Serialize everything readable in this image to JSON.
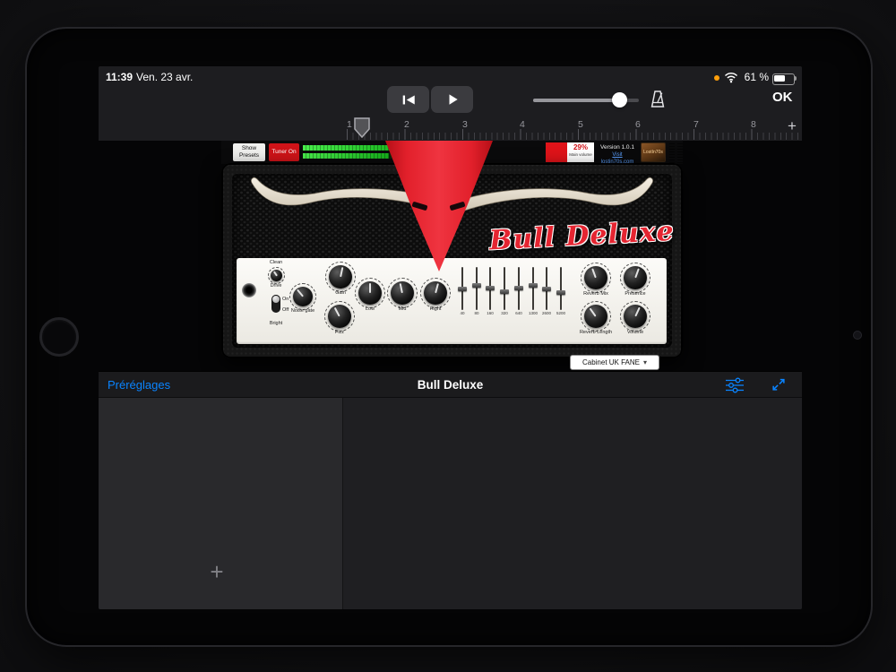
{
  "status": {
    "time": "11:39",
    "date": "Ven. 23 avr.",
    "battery": "61 %"
  },
  "toolbar": {
    "ok": "OK"
  },
  "ruler": {
    "bars": [
      "1",
      "2",
      "3",
      "4",
      "5",
      "6",
      "7",
      "8"
    ],
    "add": "+"
  },
  "plugin": {
    "strip": {
      "show_presets": "Show Presets",
      "tuner_on": "Tuner On",
      "main_volume_pct": "29%",
      "main_volume_label": "Main volume",
      "version": "Version 1.0.1",
      "link": "Visit lostin70s.com",
      "logo": "LostIn70s"
    },
    "amp": {
      "brand": "Bull Deluxe",
      "controls": {
        "clean": "Clean",
        "drive": "Drive",
        "on": "On",
        "off": "Off",
        "bright": "Bright"
      },
      "knobs": [
        "Noise gate",
        "Gain",
        "Fizz",
        "Low",
        "Mid",
        "Hight",
        "Reverb Mix",
        "Presence",
        "Reverb Length",
        "Volume"
      ],
      "eq_freqs": [
        "40",
        "80",
        "160",
        "320",
        "640",
        "1300",
        "2600",
        "5200"
      ],
      "cabinet": "Cabinet UK FANE",
      "cabinet_chevron": "▾"
    },
    "footer": {
      "presets": "Préréglages",
      "title": "Bull Deluxe"
    }
  },
  "tracks": {
    "add": "+"
  },
  "colors": {
    "accent": "#0a84ff",
    "banner_red": "#d31420",
    "brand_red": "#e52531",
    "meter_green": "#35d435",
    "battery_orange": "#ff9f0a"
  }
}
